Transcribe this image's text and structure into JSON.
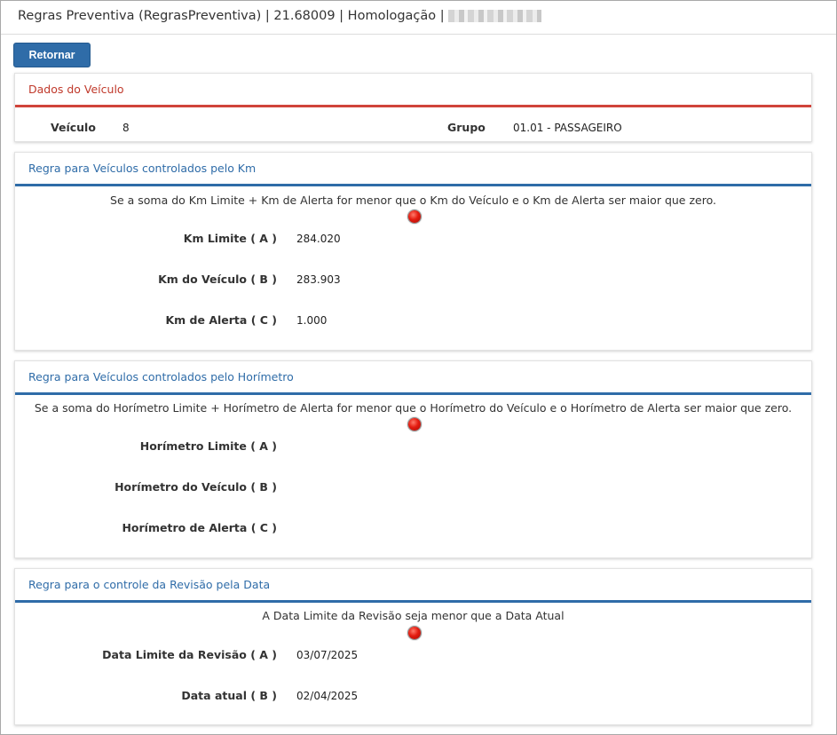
{
  "window": {
    "title": "Regras Preventiva (RegrasPreventiva) | 21.68009 | Homologação |"
  },
  "toolbar": {
    "return_label": "Retornar"
  },
  "vehicle_panel": {
    "title": "Dados do Veículo",
    "vehicle_label": "Veículo",
    "vehicle_value": "8",
    "group_label": "Grupo",
    "group_value": "01.01 - PASSAGEIRO"
  },
  "km_panel": {
    "title": "Regra para Veículos controlados pelo Km",
    "description": "Se a soma do Km Limite + Km de Alerta for menor que o Km do Veículo e o Km de Alerta ser maior que zero.",
    "status_color": "#e41c10",
    "rows": [
      {
        "label": "Km Limite ( A )",
        "value": "284.020"
      },
      {
        "label": "Km do Veículo ( B )",
        "value": "283.903"
      },
      {
        "label": "Km de Alerta ( C )",
        "value": "1.000"
      }
    ]
  },
  "hour_panel": {
    "title": "Regra para Veículos controlados pelo Horímetro",
    "description": "Se a soma do Horímetro Limite + Horímetro de Alerta for menor que o Horímetro do Veículo e o Horímetro de Alerta ser maior que zero.",
    "status_color": "#e41c10",
    "rows": [
      {
        "label": "Horímetro Limite ( A )",
        "value": ""
      },
      {
        "label": "Horímetro do Veículo ( B )",
        "value": ""
      },
      {
        "label": "Horímetro de Alerta ( C )",
        "value": ""
      }
    ]
  },
  "date_panel": {
    "title": "Regra para o controle da Revisão pela Data",
    "description": "A Data Limite da Revisão seja menor que a Data Atual",
    "status_color": "#e41c10",
    "rows": [
      {
        "label": "Data Limite da Revisão ( A )",
        "value": "03/07/2025"
      },
      {
        "label": "Data atual ( B )",
        "value": "02/04/2025"
      }
    ]
  },
  "colors": {
    "accent": "#2f6ca8",
    "vehicle_header": "#c0392b"
  }
}
